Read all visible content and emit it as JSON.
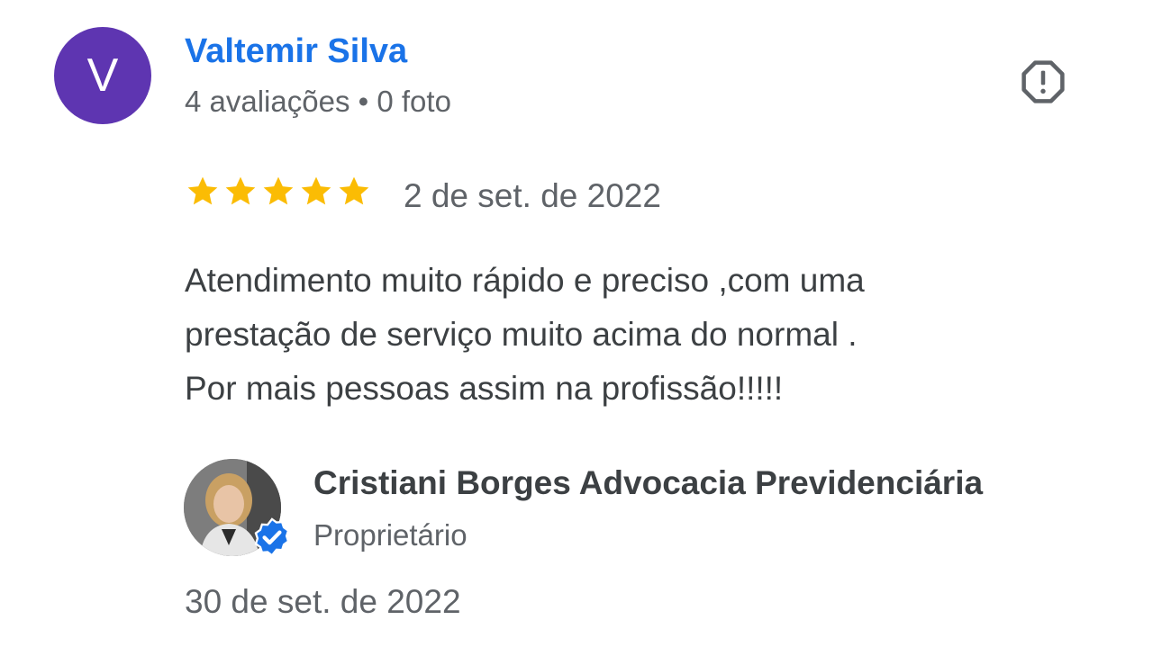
{
  "review": {
    "reviewer": {
      "initial": "V",
      "name": "Valtemir Silva",
      "reviews_count": "4 avaliações",
      "separator": "•",
      "photos_count": "0 foto",
      "avatar_color": "#5e35b1"
    },
    "report_icon": "report-octagon-icon",
    "rating": 5,
    "rating_max": 5,
    "star_color": "#fbbc04",
    "date": "2 de set. de 2022",
    "text_lines": [
      "Atendimento muito rápido e preciso ,com uma",
      "prestação de serviço muito acima do normal .",
      "Por mais pessoas assim na profissão!!!!!"
    ]
  },
  "owner_response": {
    "name": "Cristiani Borges Advocacia Previdenciária",
    "role": "Proprietário",
    "verified_icon": "verified-badge-icon",
    "date": "30 de set. de 2022"
  },
  "colors": {
    "link_blue": "#1a73e8",
    "text_dark": "#3c4043",
    "text_secondary": "#5f6368",
    "verified_blue": "#1a73e8"
  }
}
